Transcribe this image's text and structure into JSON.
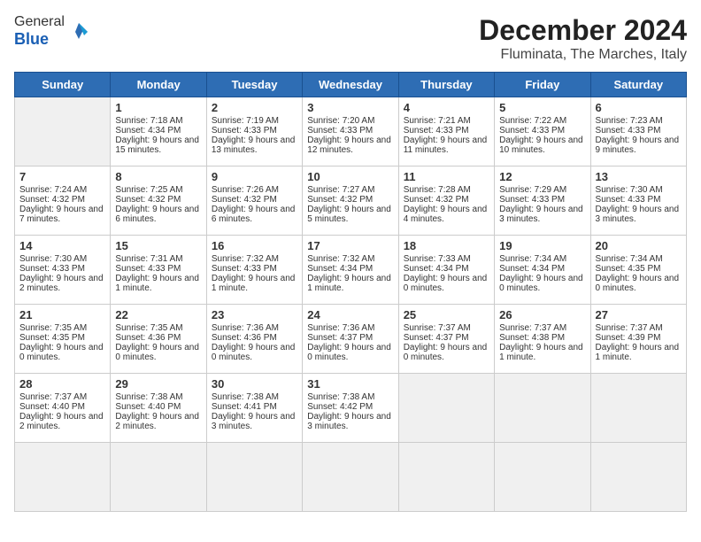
{
  "header": {
    "logo_line1": "General",
    "logo_line2": "Blue",
    "month": "December 2024",
    "location": "Fluminata, The Marches, Italy"
  },
  "weekdays": [
    "Sunday",
    "Monday",
    "Tuesday",
    "Wednesday",
    "Thursday",
    "Friday",
    "Saturday"
  ],
  "days": [
    {
      "n": "",
      "info": "",
      "empty": true
    },
    {
      "n": "1",
      "info": "Sunrise: 7:18 AM\nSunset: 4:34 PM\nDaylight: 9 hours and 15 minutes."
    },
    {
      "n": "2",
      "info": "Sunrise: 7:19 AM\nSunset: 4:33 PM\nDaylight: 9 hours and 13 minutes."
    },
    {
      "n": "3",
      "info": "Sunrise: 7:20 AM\nSunset: 4:33 PM\nDaylight: 9 hours and 12 minutes."
    },
    {
      "n": "4",
      "info": "Sunrise: 7:21 AM\nSunset: 4:33 PM\nDaylight: 9 hours and 11 minutes."
    },
    {
      "n": "5",
      "info": "Sunrise: 7:22 AM\nSunset: 4:33 PM\nDaylight: 9 hours and 10 minutes."
    },
    {
      "n": "6",
      "info": "Sunrise: 7:23 AM\nSunset: 4:33 PM\nDaylight: 9 hours and 9 minutes."
    },
    {
      "n": "7",
      "info": "Sunrise: 7:24 AM\nSunset: 4:32 PM\nDaylight: 9 hours and 7 minutes."
    },
    {
      "n": "8",
      "info": "Sunrise: 7:25 AM\nSunset: 4:32 PM\nDaylight: 9 hours and 6 minutes."
    },
    {
      "n": "9",
      "info": "Sunrise: 7:26 AM\nSunset: 4:32 PM\nDaylight: 9 hours and 6 minutes."
    },
    {
      "n": "10",
      "info": "Sunrise: 7:27 AM\nSunset: 4:32 PM\nDaylight: 9 hours and 5 minutes."
    },
    {
      "n": "11",
      "info": "Sunrise: 7:28 AM\nSunset: 4:32 PM\nDaylight: 9 hours and 4 minutes."
    },
    {
      "n": "12",
      "info": "Sunrise: 7:29 AM\nSunset: 4:33 PM\nDaylight: 9 hours and 3 minutes."
    },
    {
      "n": "13",
      "info": "Sunrise: 7:30 AM\nSunset: 4:33 PM\nDaylight: 9 hours and 3 minutes."
    },
    {
      "n": "14",
      "info": "Sunrise: 7:30 AM\nSunset: 4:33 PM\nDaylight: 9 hours and 2 minutes."
    },
    {
      "n": "15",
      "info": "Sunrise: 7:31 AM\nSunset: 4:33 PM\nDaylight: 9 hours and 1 minute."
    },
    {
      "n": "16",
      "info": "Sunrise: 7:32 AM\nSunset: 4:33 PM\nDaylight: 9 hours and 1 minute."
    },
    {
      "n": "17",
      "info": "Sunrise: 7:32 AM\nSunset: 4:34 PM\nDaylight: 9 hours and 1 minute."
    },
    {
      "n": "18",
      "info": "Sunrise: 7:33 AM\nSunset: 4:34 PM\nDaylight: 9 hours and 0 minutes."
    },
    {
      "n": "19",
      "info": "Sunrise: 7:34 AM\nSunset: 4:34 PM\nDaylight: 9 hours and 0 minutes."
    },
    {
      "n": "20",
      "info": "Sunrise: 7:34 AM\nSunset: 4:35 PM\nDaylight: 9 hours and 0 minutes."
    },
    {
      "n": "21",
      "info": "Sunrise: 7:35 AM\nSunset: 4:35 PM\nDaylight: 9 hours and 0 minutes."
    },
    {
      "n": "22",
      "info": "Sunrise: 7:35 AM\nSunset: 4:36 PM\nDaylight: 9 hours and 0 minutes."
    },
    {
      "n": "23",
      "info": "Sunrise: 7:36 AM\nSunset: 4:36 PM\nDaylight: 9 hours and 0 minutes."
    },
    {
      "n": "24",
      "info": "Sunrise: 7:36 AM\nSunset: 4:37 PM\nDaylight: 9 hours and 0 minutes."
    },
    {
      "n": "25",
      "info": "Sunrise: 7:37 AM\nSunset: 4:37 PM\nDaylight: 9 hours and 0 minutes."
    },
    {
      "n": "26",
      "info": "Sunrise: 7:37 AM\nSunset: 4:38 PM\nDaylight: 9 hours and 1 minute."
    },
    {
      "n": "27",
      "info": "Sunrise: 7:37 AM\nSunset: 4:39 PM\nDaylight: 9 hours and 1 minute."
    },
    {
      "n": "28",
      "info": "Sunrise: 7:37 AM\nSunset: 4:40 PM\nDaylight: 9 hours and 2 minutes."
    },
    {
      "n": "29",
      "info": "Sunrise: 7:38 AM\nSunset: 4:40 PM\nDaylight: 9 hours and 2 minutes."
    },
    {
      "n": "30",
      "info": "Sunrise: 7:38 AM\nSunset: 4:41 PM\nDaylight: 9 hours and 3 minutes."
    },
    {
      "n": "31",
      "info": "Sunrise: 7:38 AM\nSunset: 4:42 PM\nDaylight: 9 hours and 3 minutes."
    },
    {
      "n": "",
      "info": "",
      "empty": true
    },
    {
      "n": "",
      "info": "",
      "empty": true
    },
    {
      "n": "",
      "info": "",
      "empty": true
    },
    {
      "n": "",
      "info": "",
      "empty": true
    }
  ]
}
